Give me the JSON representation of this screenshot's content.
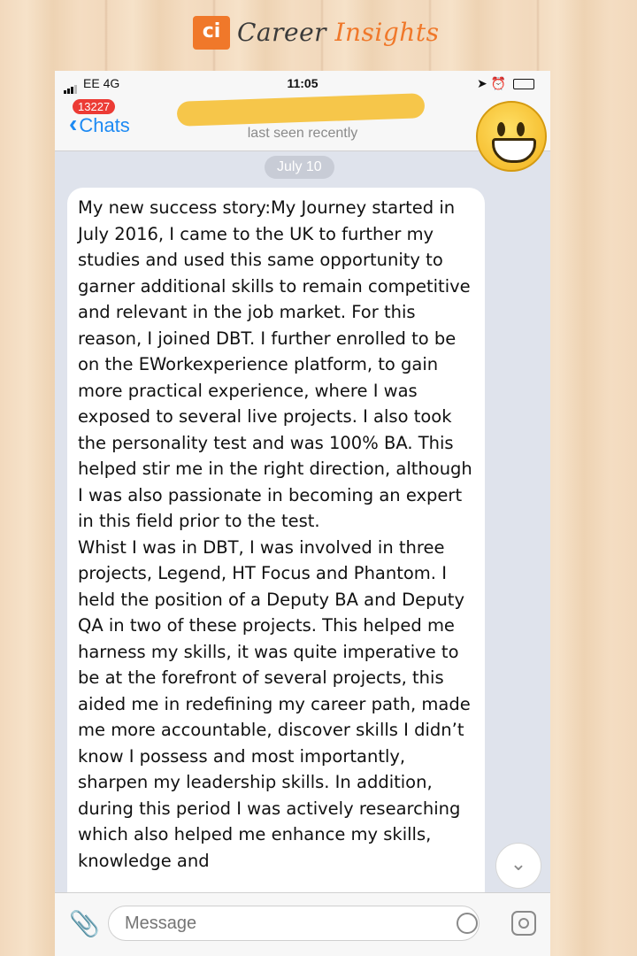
{
  "brand": {
    "logo_text": "ci",
    "career": "Career",
    "insights": "Insights"
  },
  "status_bar": {
    "carrier": "EE  4G",
    "time": "11:05"
  },
  "header": {
    "back_label": "Chats",
    "unread_badge": "13227",
    "last_seen": "last seen recently"
  },
  "chat": {
    "date_pill": "July 10",
    "message": "My new success story:My Journey started in July 2016, I came to the UK to further my studies and used this same opportunity to garner additional skills to remain competitive and relevant in the job market. For this reason, I joined DBT. I further enrolled to be on the EWorkexperience platform, to gain more practical experience, where I was exposed to several live projects. I also took the personality test and was 100% BA. This helped stir me in the right direction, although I was also passionate in becoming an expert in this field prior to the test.\nWhist I was in DBT, I was involved in three projects, Legend, HT Focus and Phantom. I held the position of a Deputy BA and Deputy QA in two of these projects. This helped me harness my skills, it was quite imperative to be at the forefront of several projects, this aided me in redefining my career path, made me more accountable, discover skills I didn’t know I possess and most importantly, sharpen my leadership skills. In addition, during this period I was actively researching which also helped me enhance my skills, knowledge and"
  },
  "composer": {
    "placeholder": "Message"
  },
  "icons": {
    "back": "chevron-left-icon",
    "scroll": "chevron-down-icon",
    "attach": "paperclip-icon",
    "sticker": "sticker-icon",
    "camera": "camera-icon"
  }
}
